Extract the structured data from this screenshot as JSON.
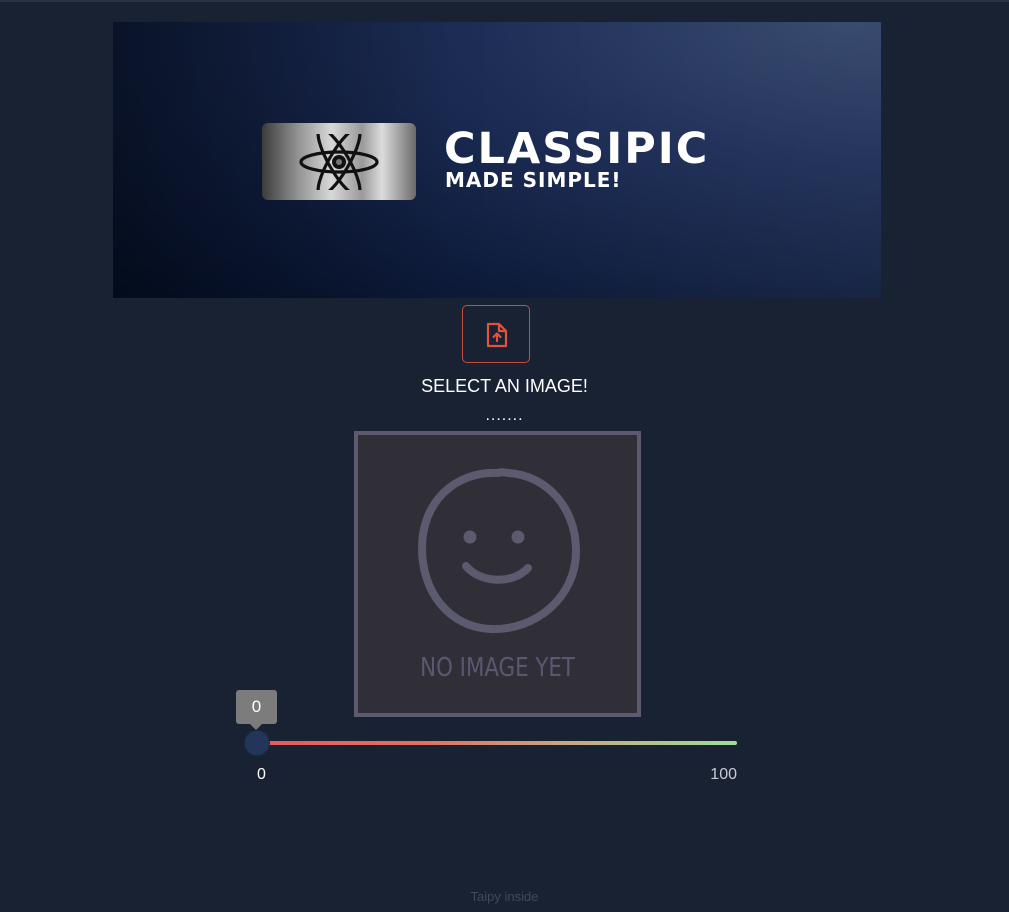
{
  "banner": {
    "title": "CLASSIPIC",
    "subtitle": "MADE SIMPLE!"
  },
  "upload": {
    "icon": "file-upload-icon",
    "accent": "#e0533e"
  },
  "labels": {
    "select_image": "SELECT AN IMAGE!",
    "dots": "......."
  },
  "placeholder": {
    "text": "NO IMAGE YET",
    "icon": "smiley-face-icon"
  },
  "slider": {
    "value": "0",
    "min": "0",
    "max": "100"
  },
  "footer": {
    "text": "Taipy inside"
  }
}
